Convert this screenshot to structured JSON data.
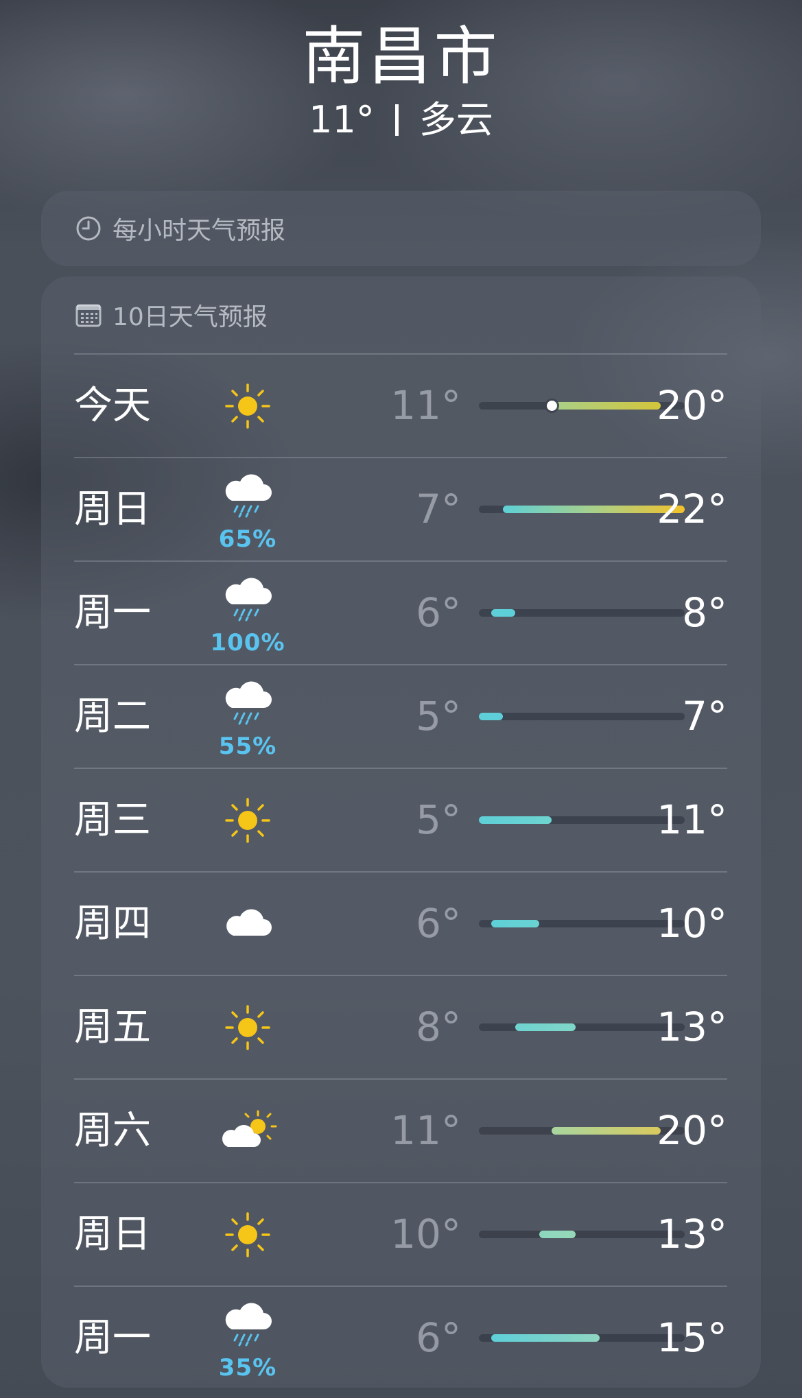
{
  "location": {
    "city": "南昌市",
    "current_temp": "11°",
    "condition": "多云"
  },
  "hourly_card": {
    "title": "每小时天气预报",
    "icon": "clock-icon"
  },
  "daily_card": {
    "title": "10日天气预报",
    "icon": "calendar-icon",
    "range_min": 5,
    "range_max": 22,
    "days": [
      {
        "day": "今天",
        "icon": "sun-icon",
        "precip": "",
        "low": "11°",
        "high": "20°",
        "low_val": 11,
        "high_val": 20,
        "current_val": 11,
        "colors": [
          "#a8d08a",
          "#d4c53a"
        ]
      },
      {
        "day": "周日",
        "icon": "rain-cloud-icon",
        "precip": "65%",
        "low": "7°",
        "high": "22°",
        "low_val": 7,
        "high_val": 22,
        "colors": [
          "#5ed0d6",
          "#a8d08a",
          "#f2c22a"
        ]
      },
      {
        "day": "周一",
        "icon": "rain-cloud-icon",
        "precip": "100%",
        "low": "6°",
        "high": "8°",
        "low_val": 6,
        "high_val": 8,
        "colors": [
          "#5ecfd8",
          "#5ecfd8"
        ]
      },
      {
        "day": "周二",
        "icon": "rain-cloud-icon",
        "precip": "55%",
        "low": "5°",
        "high": "7°",
        "low_val": 5,
        "high_val": 7,
        "colors": [
          "#5ecfd8",
          "#5ecfd8"
        ]
      },
      {
        "day": "周三",
        "icon": "sun-icon",
        "precip": "",
        "low": "5°",
        "high": "11°",
        "low_val": 5,
        "high_val": 11,
        "colors": [
          "#5ecfd8",
          "#6ed4d0"
        ]
      },
      {
        "day": "周四",
        "icon": "cloud-icon",
        "precip": "",
        "low": "6°",
        "high": "10°",
        "low_val": 6,
        "high_val": 10,
        "colors": [
          "#5ecfd8",
          "#6ad3d2"
        ]
      },
      {
        "day": "周五",
        "icon": "sun-icon",
        "precip": "",
        "low": "8°",
        "high": "13°",
        "low_val": 8,
        "high_val": 13,
        "colors": [
          "#6fd3d0",
          "#7fd6c8"
        ]
      },
      {
        "day": "周六",
        "icon": "partly-cloudy-icon",
        "precip": "",
        "low": "11°",
        "high": "20°",
        "low_val": 11,
        "high_val": 20,
        "colors": [
          "#a8d6a0",
          "#d9c95e"
        ]
      },
      {
        "day": "周日",
        "icon": "sun-icon",
        "precip": "",
        "low": "10°",
        "high": "13°",
        "low_val": 10,
        "high_val": 13,
        "colors": [
          "#8cd6bf",
          "#96d8b8"
        ]
      },
      {
        "day": "周一",
        "icon": "rain-cloud-icon",
        "precip": "35%",
        "low": "6°",
        "high": "15°",
        "low_val": 6,
        "high_val": 15,
        "colors": [
          "#5ecfd8",
          "#8fd5c2"
        ]
      }
    ]
  }
}
